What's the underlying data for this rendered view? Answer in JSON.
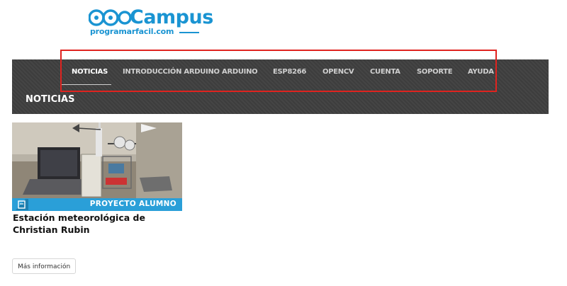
{
  "logo": {
    "wordmark": "Campus",
    "url_text": "programarfacil.com",
    "color": "#1a94d2"
  },
  "nav": {
    "items": [
      {
        "label": "NOTICIAS",
        "active": true
      },
      {
        "label": "INTRODUCCIÓN ARDUINO",
        "active": false
      },
      {
        "label": "ARDUINO",
        "active": false
      },
      {
        "label": "ESP8266",
        "active": false
      },
      {
        "label": "OPENCV",
        "active": false
      },
      {
        "label": "CUENTA",
        "active": false
      },
      {
        "label": "SOPORTE",
        "active": false
      },
      {
        "label": "AYUDA",
        "active": false
      }
    ]
  },
  "section": {
    "title": "NOTICIAS"
  },
  "post": {
    "badge_label": "PROYECTO ALUMNO",
    "title": "Estación meteorológica de Christian Rubin",
    "more_label": "Más información"
  },
  "colors": {
    "accent": "#2a9fd8",
    "nav_background": "#404040",
    "highlight_box": "#e0231f"
  }
}
